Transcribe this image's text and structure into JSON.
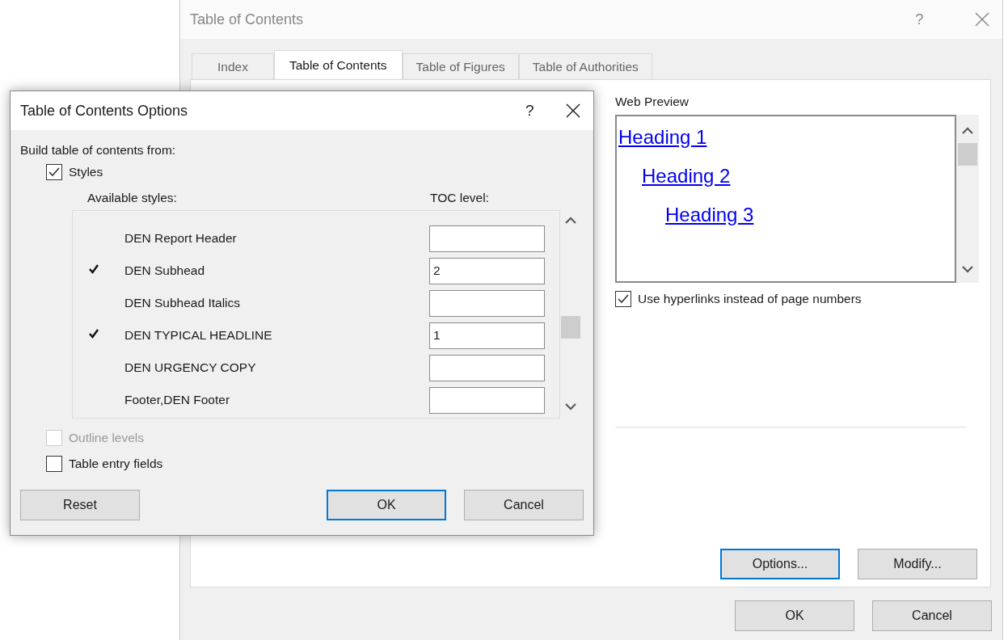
{
  "window": {
    "title": "Table of Contents",
    "help": "?"
  },
  "tabs": [
    {
      "label": "Index",
      "selected": false
    },
    {
      "label": "Table of Contents",
      "selected": true
    },
    {
      "label": "Table of Figures",
      "selected": false
    },
    {
      "label": "Table of Authorities",
      "selected": false
    }
  ],
  "web_preview": {
    "label": "Web Preview",
    "headings": [
      {
        "text": "Heading 1",
        "children": [
          {
            "text": "Heading 2",
            "children": [
              {
                "text": "Heading 3"
              }
            ]
          }
        ]
      }
    ]
  },
  "use_hyperlinks": {
    "label": "Use hyperlinks instead of page numbers",
    "checked": true
  },
  "panel_buttons": [
    {
      "label": "Options...",
      "focused": true
    },
    {
      "label": "Modify...",
      "focused": false
    }
  ],
  "buttons": [
    {
      "label": "OK",
      "focused": false
    },
    {
      "label": "Cancel",
      "focused": false
    }
  ],
  "options_dialog": {
    "title": "Table of Contents Options",
    "help": "?",
    "build_label": "Build table of contents from:",
    "styles": {
      "label": "Styles",
      "checked": true
    },
    "columns": [
      "Available styles:",
      "TOC level:"
    ],
    "rows": [
      {
        "name": "DEN Report Header",
        "in_toc": false
      },
      {
        "name": "DEN Subhead",
        "in_toc": true,
        "level": "2"
      },
      {
        "name": "DEN Subhead Italics",
        "in_toc": false
      },
      {
        "name": "DEN TYPICAL HEADLINE",
        "in_toc": true,
        "level": "1"
      },
      {
        "name": "DEN URGENCY COPY",
        "in_toc": false
      },
      {
        "name": "Footer,DEN Footer",
        "in_toc": false
      }
    ],
    "outline_levels": {
      "label": "Outline levels",
      "checked": false,
      "disabled": true
    },
    "table_entry_fields": {
      "label": "Table entry fields",
      "checked": false,
      "disabled": false
    },
    "buttons": [
      {
        "label": "Reset",
        "focused": false
      },
      {
        "label": "OK",
        "focused": true
      },
      {
        "label": "Cancel",
        "focused": false
      }
    ]
  }
}
